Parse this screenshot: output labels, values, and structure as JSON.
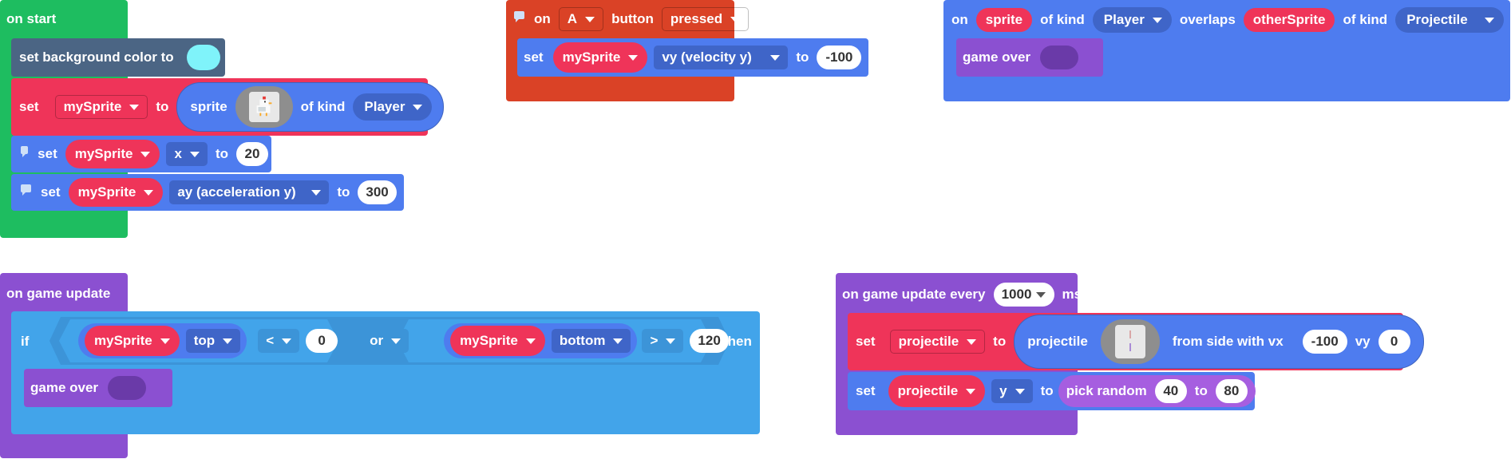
{
  "colors": {
    "green": "#1ebd60",
    "slate": "#4b6584",
    "red": "#ef3459",
    "blue": "#4e7cef",
    "lightblue": "#42a4ea",
    "purple": "#8b50d1",
    "orange": "#da4226",
    "cyan": "#7ff3fa"
  },
  "on_start": {
    "label": "on start",
    "bg": {
      "label": "set background color to"
    },
    "set_sprite": {
      "set": "set",
      "var": "mySprite",
      "to": "to",
      "sprite": "sprite",
      "of_kind": "of kind",
      "kind": "Player"
    },
    "set_x": {
      "set": "set",
      "var": "mySprite",
      "prop": "x",
      "to": "to",
      "value": "20"
    },
    "set_ay": {
      "set": "set",
      "var": "mySprite",
      "prop": "ay (acceleration y)",
      "to": "to",
      "value": "300"
    }
  },
  "on_a": {
    "on": "on",
    "button": "A",
    "button_label": "button",
    "event": "pressed",
    "set": "set",
    "var": "mySprite",
    "prop": "vy (velocity y)",
    "to": "to",
    "value": "-100"
  },
  "on_overlap": {
    "on": "on",
    "sprite": "sprite",
    "of_kind1": "of kind",
    "kind1": "Player",
    "overlaps": "overlaps",
    "other": "otherSprite",
    "of_kind2": "of kind",
    "kind2": "Projectile",
    "game_over": "game over"
  },
  "on_update": {
    "label": "on game update",
    "if": "if",
    "left": {
      "var": "mySprite",
      "prop": "top",
      "op": "<",
      "value": "0"
    },
    "or": "or",
    "right": {
      "var": "mySprite",
      "prop": "bottom",
      "op": ">",
      "value": "120"
    },
    "then": "then",
    "game_over": "game over"
  },
  "on_every": {
    "label": "on game update every",
    "interval": "1000",
    "unit": "ms",
    "set1": {
      "set": "set",
      "var": "projectile",
      "to": "to",
      "projectile": "projectile",
      "from_side": "from side with vx",
      "vx": "-100",
      "vy_label": "vy",
      "vy": "0"
    },
    "set2": {
      "set": "set",
      "var": "projectile",
      "prop": "y",
      "to": "to",
      "random": "pick random",
      "min": "40",
      "to2": "to",
      "max": "80"
    }
  }
}
